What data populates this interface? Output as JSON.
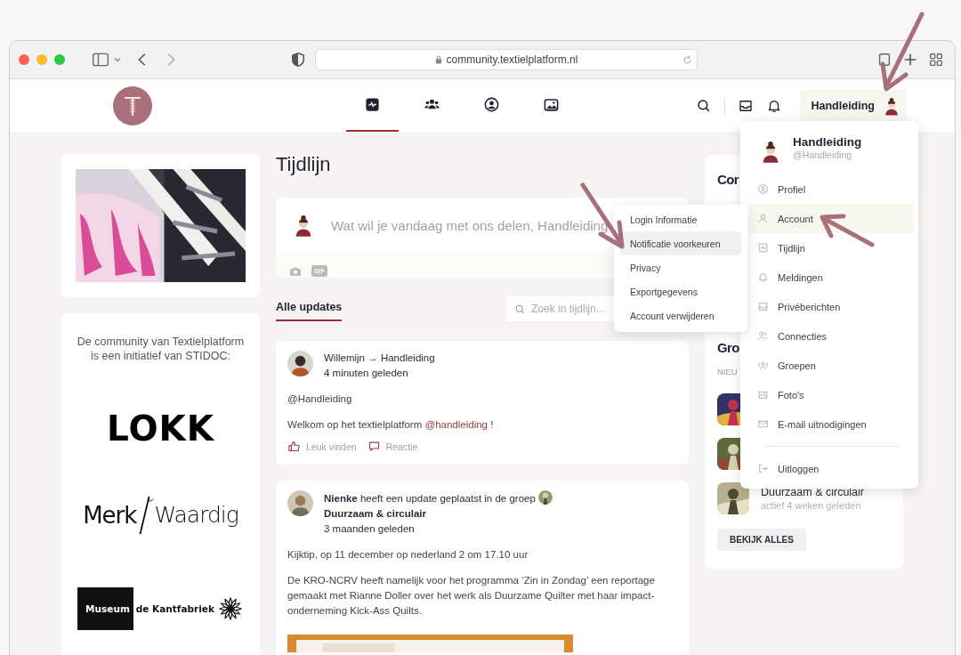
{
  "browser": {
    "url": "community.textielplatform.nl"
  },
  "nav": {
    "tabs": [
      {
        "kind": "activity",
        "selected": true
      },
      {
        "kind": "members",
        "selected": false
      },
      {
        "kind": "profile",
        "selected": false
      },
      {
        "kind": "photos",
        "selected": false
      }
    ],
    "user_button": "Handleiding"
  },
  "sponsors": {
    "intro": "De community van Textielplatform is een initiatief van STIDOC:",
    "logos": [
      {
        "kind": "lokk",
        "parts": [
          "LOKK"
        ]
      },
      {
        "kind": "merkwaardig",
        "parts": [
          "Merk",
          "Waardig"
        ]
      },
      {
        "kind": "museum",
        "parts": [
          "Museum",
          "de Kantfabriek"
        ]
      }
    ]
  },
  "timeline": {
    "title": "Tijdlijn",
    "composer": {
      "placeholder": "Wat wil je vandaag met ons delen, Handleiding",
      "tools": [
        {
          "kind": "camera"
        },
        {
          "kind": "gif",
          "label": "GIF"
        }
      ]
    },
    "tabs": [
      {
        "label": "Alle updates",
        "selected": true
      }
    ],
    "search": {
      "placeholder": "Zoek in tijdlijn..."
    },
    "posts": [
      {
        "kind": "direct",
        "header": "Willemijn → Handleiding",
        "time": "4 minuten geleden",
        "paragraphs": [
          {
            "text": "@Handleiding"
          },
          {
            "text": "Welkom op het textielplatform ",
            "mention": "@handleiding",
            "after": " !"
          }
        ],
        "actions": [
          {
            "kind": "like",
            "label": "Leuk vinden"
          },
          {
            "kind": "comment",
            "label": "Reactie"
          }
        ]
      },
      {
        "kind": "group",
        "header": "**Nienke** heeft een update geplaatst in de groep",
        "group": "Duurzaam & circulair",
        "time": "3 maanden geleden",
        "paragraphs": [
          {
            "text": "Kijktip, op 11 december op nederland 2 om 17.10 uur"
          },
          {
            "text": "De KRO-NCRV heeft namelijk voor het programma ‘Zin in Zondag’ een reportage gemaakt met Rianne Doller over het werk als Duurzame Quilter met haar impact-onderneming Kick-Ass Quilts."
          }
        ],
        "media": {
          "kind": "picture"
        }
      }
    ]
  },
  "sidebar": {
    "headings": [
      "Cor",
      "Gro"
    ],
    "label": "NIEU",
    "groups": [
      {
        "kind": "picture"
      },
      {
        "kind": "picture"
      },
      {
        "kind": "picture",
        "name": "Duurzaam & circulair",
        "activity": "actief 4 weken geleden"
      }
    ],
    "button": "BEKIJK ALLES"
  },
  "account_menu": {
    "name": "Handleiding",
    "handle": "@Handleiding",
    "items": [
      {
        "kind": "profile",
        "label": "Profiel",
        "selected": false
      },
      {
        "kind": "user",
        "label": "Account",
        "selected": true
      },
      {
        "kind": "activity",
        "label": "Tijdlijn",
        "selected": false
      },
      {
        "kind": "bell",
        "label": "Meldingen",
        "selected": false
      },
      {
        "kind": "inbox",
        "label": "Privéberichten",
        "selected": false
      },
      {
        "kind": "users",
        "label": "Connecties",
        "selected": false
      },
      {
        "kind": "group",
        "label": "Groepen",
        "selected": false
      },
      {
        "kind": "photos",
        "label": "Foto's",
        "selected": false
      },
      {
        "kind": "mail",
        "label": "E-mail uitnodigingen",
        "selected": false
      }
    ],
    "logout": {
      "kind": "logout",
      "label": "Uitloggen"
    }
  },
  "account_submenu": {
    "items": [
      {
        "label": "Login Informatie",
        "selected": false
      },
      {
        "label": "Notificatie voorkeuren",
        "selected": true
      },
      {
        "label": "Privacy",
        "selected": false
      },
      {
        "label": "Exportgegevens",
        "selected": false
      },
      {
        "label": "Account verwijderen",
        "selected": false
      }
    ]
  }
}
